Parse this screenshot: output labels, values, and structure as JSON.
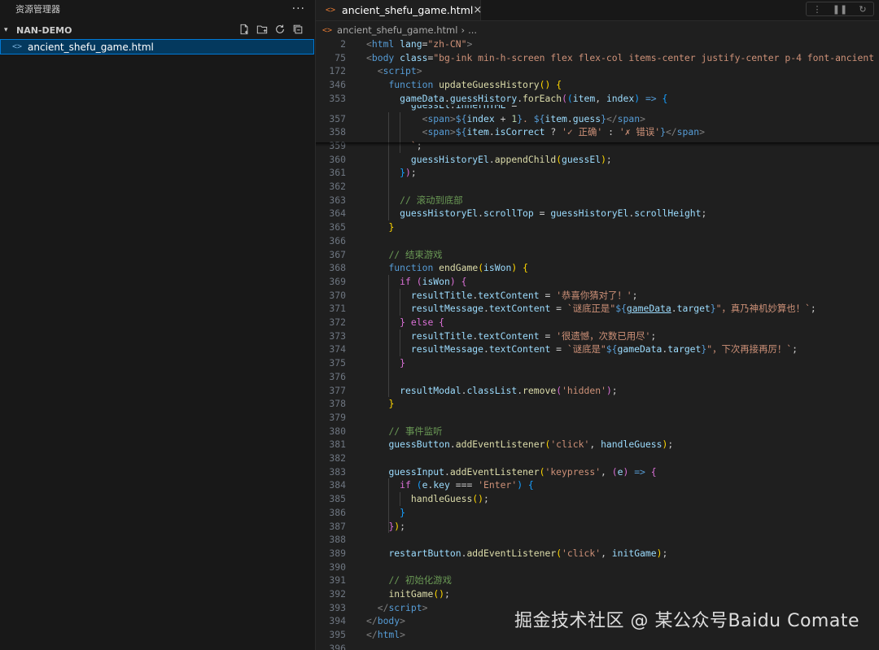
{
  "sidebar": {
    "title": "资源管理器",
    "more": "···",
    "section": "NAN-DEMO",
    "file": "ancient_shefu_game.html",
    "file_icon": "<>"
  },
  "tab": {
    "label": "ancient_shefu_game.html",
    "icon": "<>",
    "close": "×"
  },
  "breadcrumb": {
    "file": "ancient_shefu_game.html",
    "sep": "›",
    "rest": "..."
  },
  "sticky_lines": [
    {
      "n": "2",
      "html": "<span class=\"p\">&lt;</span><span class=\"k\">html</span> <span class=\"a\">lang</span>=<span class=\"s\">\"zh-CN\"</span><span class=\"p\">&gt;</span>"
    },
    {
      "n": "75",
      "html": "<span class=\"p\">&lt;</span><span class=\"k\">body</span> <span class=\"a\">class</span>=<span class=\"s\">\"bg-ink min-h-screen flex flex-col items-center justify-center p-4 font-ancient te</span>"
    },
    {
      "n": "172",
      "html": "  <span class=\"p\">&lt;</span><span class=\"k\">script</span><span class=\"p\">&gt;</span>"
    },
    {
      "n": "346",
      "html": "    <span class=\"k\">function</span> <span class=\"f\">updateGuessHistory</span><span class=\"y\">()</span> <span class=\"y\">{</span>"
    },
    {
      "n": "353",
      "html": "      <span class=\"a\">gameData</span>.<span class=\"a\">guessHistory</span>.<span class=\"f\">forEach</span><span class=\"m\">(</span><span class=\"b\">(</span><span class=\"a\">item</span>, <span class=\"a\">index</span><span class=\"b\">)</span> <span class=\"k\">=&gt;</span> <span class=\"b\">{</span>"
    }
  ],
  "code_lines": [
    {
      "n": "357",
      "html": "          <span class=\"p\">&lt;</span><span class=\"k\">span</span><span class=\"p\">&gt;</span><span class=\"k\">${</span><span class=\"a\">index</span> + <span class=\"n\">1</span><span class=\"k\">}</span><span class=\"s\">. </span><span class=\"k\">${</span><span class=\"a\">item</span>.<span class=\"a\">guess</span><span class=\"k\">}</span><span class=\"p\">&lt;/</span><span class=\"k\">span</span><span class=\"p\">&gt;</span>"
    },
    {
      "n": "358",
      "html": "          <span class=\"p\">&lt;</span><span class=\"k\">span</span><span class=\"p\">&gt;</span><span class=\"k\">${</span><span class=\"a\">item</span>.<span class=\"a\">isCorrect</span> ? <span class=\"s\">'✓ 正确'</span> : <span class=\"s\">'✗ 错误'</span><span class=\"k\">}</span><span class=\"p\">&lt;/</span><span class=\"k\">span</span><span class=\"p\">&gt;</span>"
    },
    {
      "n": "359",
      "html": "        <span class=\"s\">`</span>;"
    },
    {
      "n": "360",
      "html": "        <span class=\"a\">guessHistoryEl</span>.<span class=\"f\">appendChild</span><span class=\"y\">(</span><span class=\"a\">guessEl</span><span class=\"y\">)</span>;"
    },
    {
      "n": "361",
      "html": "      <span class=\"b\">}</span><span class=\"m\">)</span>;"
    },
    {
      "n": "362",
      "html": ""
    },
    {
      "n": "363",
      "html": "      <span class=\"c\">// 滚动到底部</span>"
    },
    {
      "n": "364",
      "html": "      <span class=\"a\">guessHistoryEl</span>.<span class=\"a\">scrollTop</span> = <span class=\"a\">guessHistoryEl</span>.<span class=\"a\">scrollHeight</span>;"
    },
    {
      "n": "365",
      "html": "    <span class=\"y\">}</span>"
    },
    {
      "n": "366",
      "html": ""
    },
    {
      "n": "367",
      "html": "    <span class=\"c\">// 结束游戏</span>"
    },
    {
      "n": "368",
      "html": "    <span class=\"k\">function</span> <span class=\"f\">endGame</span><span class=\"y\">(</span><span class=\"a\">isWon</span><span class=\"y\">)</span> <span class=\"y\">{</span>"
    },
    {
      "n": "369",
      "html": "      <span class=\"m\">if</span> <span class=\"m\">(</span><span class=\"a\">isWon</span><span class=\"m\">)</span> <span class=\"m\">{</span>"
    },
    {
      "n": "370",
      "html": "        <span class=\"a\">resultTitle</span>.<span class=\"a\">textContent</span> = <span class=\"s\">'恭喜你猜对了！'</span>;"
    },
    {
      "n": "371",
      "html": "        <span class=\"a\">resultMessage</span>.<span class=\"a\">textContent</span> = <span class=\"s\">`谜底正是\"</span><span class=\"k\">${</span><span class=\"a u\">gameData</span>.<span class=\"a\">target</span><span class=\"k\">}</span><span class=\"s\">\"，真乃神机妙算也！`</span>;"
    },
    {
      "n": "372",
      "html": "      <span class=\"m\">}</span> <span class=\"m\">else</span> <span class=\"m\">{</span>"
    },
    {
      "n": "373",
      "html": "        <span class=\"a\">resultTitle</span>.<span class=\"a\">textContent</span> = <span class=\"s\">'很遗憾，次数已用尽'</span>;"
    },
    {
      "n": "374",
      "html": "        <span class=\"a\">resultMessage</span>.<span class=\"a\">textContent</span> = <span class=\"s\">`谜底是\"</span><span class=\"k\">${</span><span class=\"a\">gameData</span>.<span class=\"a\">target</span><span class=\"k\">}</span><span class=\"s\">\"，下次再接再厉！`</span>;"
    },
    {
      "n": "375",
      "html": "      <span class=\"m\">}</span>"
    },
    {
      "n": "376",
      "html": ""
    },
    {
      "n": "377",
      "html": "      <span class=\"a\">resultModal</span>.<span class=\"a\">classList</span>.<span class=\"f\">remove</span><span class=\"m\">(</span><span class=\"s\">'hidden'</span><span class=\"m\">)</span>;"
    },
    {
      "n": "378",
      "html": "    <span class=\"y\">}</span>"
    },
    {
      "n": "379",
      "html": ""
    },
    {
      "n": "380",
      "html": "    <span class=\"c\">// 事件监听</span>"
    },
    {
      "n": "381",
      "html": "    <span class=\"a\">guessButton</span>.<span class=\"f\">addEventListener</span><span class=\"y\">(</span><span class=\"s\">'click'</span>, <span class=\"a\">handleGuess</span><span class=\"y\">)</span>;"
    },
    {
      "n": "382",
      "html": ""
    },
    {
      "n": "383",
      "html": "    <span class=\"a\">guessInput</span>.<span class=\"f\">addEventListener</span><span class=\"y\">(</span><span class=\"s\">'keypress'</span>, <span class=\"m\">(</span><span class=\"a\">e</span><span class=\"m\">)</span> <span class=\"k\">=&gt;</span> <span class=\"m\">{</span>"
    },
    {
      "n": "384",
      "html": "      <span class=\"m\">if</span> <span class=\"b\">(</span><span class=\"a\">e</span>.<span class=\"a\">key</span> === <span class=\"s\">'Enter'</span><span class=\"b\">)</span> <span class=\"b\">{</span>"
    },
    {
      "n": "385",
      "html": "        <span class=\"f\">handleGuess</span><span class=\"y\">()</span>;"
    },
    {
      "n": "386",
      "html": "      <span class=\"b\">}</span>"
    },
    {
      "n": "387",
      "html": "    <span class=\"m\">}</span><span class=\"y\">)</span>;"
    },
    {
      "n": "388",
      "html": ""
    },
    {
      "n": "389",
      "html": "    <span class=\"a\">restartButton</span>.<span class=\"f\">addEventListener</span><span class=\"y\">(</span><span class=\"s\">'click'</span>, <span class=\"a\">initGame</span><span class=\"y\">)</span>;"
    },
    {
      "n": "390",
      "html": ""
    },
    {
      "n": "391",
      "html": "    <span class=\"c\">// 初始化游戏</span>"
    },
    {
      "n": "392",
      "html": "    <span class=\"f\">initGame</span><span class=\"y\">()</span>;"
    },
    {
      "n": "393",
      "html": "  <span class=\"p\">&lt;/</span><span class=\"k\">script</span><span class=\"p\">&gt;</span>"
    },
    {
      "n": "394",
      "html": "<span class=\"p\">&lt;/</span><span class=\"k\">body</span><span class=\"p\">&gt;</span>"
    },
    {
      "n": "395",
      "html": "<span class=\"p\">&lt;/</span><span class=\"k\">html</span><span class=\"p\">&gt;</span>"
    },
    {
      "n": "396",
      "html": ""
    }
  ],
  "watermark": "掘金技术社区 @ 某公众号Baidu Comate"
}
